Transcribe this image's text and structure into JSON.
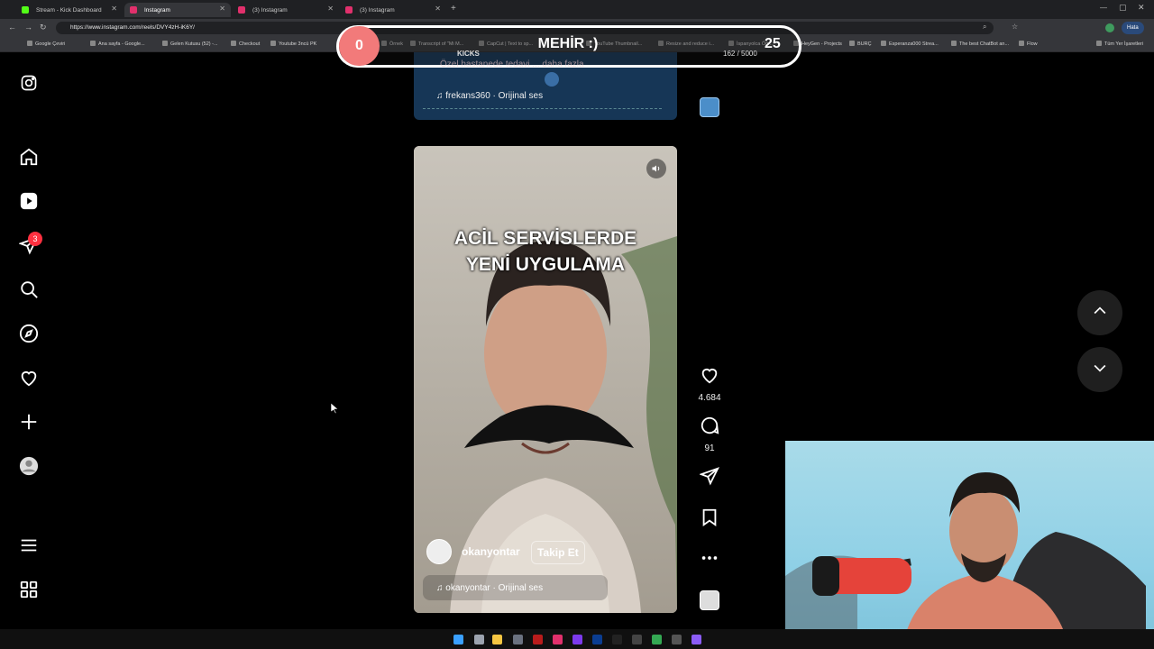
{
  "browser": {
    "tabs": [
      {
        "title": "Stream - Kick Dashboard",
        "color": "#53fc18"
      },
      {
        "title": "Instagram",
        "color": "#e1306c"
      },
      {
        "title": "(3) Instagram",
        "color": "#e1306c"
      },
      {
        "title": "(3) Instagram",
        "color": "#e1306c"
      }
    ],
    "url": "https://www.instagram.com/reels/DVY4zH-iK6Y/",
    "profile_label": "Hata",
    "bookmarks": [
      "Google Çeviri",
      "Ana sayfa - Google...",
      "Gelen Kutusu (52) -...",
      "Checkout",
      "Youtube 3ncü PK",
      "Örnek",
      "Transcript of \"Mi M...",
      "CapCut | Text to sp...",
      "YouTube Thumbnail...",
      "Resize and reduce i...",
      "İspanyolca Öğr...",
      "HeyGen - Projects",
      "BURÇ",
      "Esperanza000 Strea...",
      "The best ChatBot an...",
      "Flow",
      "Tüm Yer İşaretleri"
    ]
  },
  "overlay": {
    "left_count": "0",
    "title": "MEHİR :)",
    "right_count": "25",
    "kicks_label": "KICKS",
    "kicks_progress": "162 / 5000",
    "ticker": "Özel hastanede tedavi ... daha fazla"
  },
  "sidebar": {
    "icons": [
      "instagram-logo-icon",
      "home-icon",
      "reels-icon",
      "messages-icon",
      "search-icon",
      "explore-icon",
      "notifications-icon",
      "create-icon",
      "profile-icon",
      "more-menu-icon",
      "also-from-meta-icon"
    ],
    "messages_badge": "3"
  },
  "previous_reel": {
    "audio": "frekans360 · Orijinal ses"
  },
  "reel": {
    "caption_line1": "ACİL SERVİSLERDE",
    "caption_line2": "YENİ UYGULAMA",
    "author": "okanyontar",
    "follow_label": "Takip Et",
    "audio": "okanyontar · Orijinal ses",
    "likes": "4.684",
    "comments": "91"
  },
  "colors": {
    "background": "#000000",
    "overlay_accent": "#f27a7a",
    "notification_badge": "#ff3040"
  }
}
